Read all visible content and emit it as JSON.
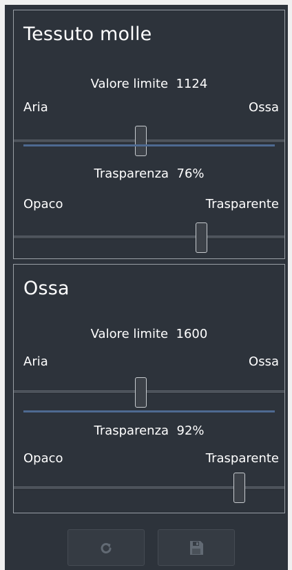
{
  "sections": [
    {
      "title": "Tessuto molle",
      "threshold": {
        "label": "Valore limite",
        "value": "1124",
        "min_label": "Aria",
        "max_label": "Ossa",
        "level": 0.5
      },
      "transparency": {
        "label": "Trasparenza",
        "value": "76%",
        "min_label": "Opaco",
        "max_label": "Trasparente",
        "level": 0.76
      }
    },
    {
      "title": "Ossa",
      "threshold": {
        "label": "Valore limite",
        "value": "1600",
        "min_label": "Aria",
        "max_label": "Ossa",
        "level": 0.5
      },
      "transparency": {
        "label": "Trasparenza",
        "value": "92%",
        "min_label": "Opaco",
        "max_label": "Trasparente",
        "level": 0.92
      }
    }
  ],
  "toolbar": {
    "reset_icon": "reset-icon",
    "save_icon": "save-icon"
  },
  "colors": {
    "panel_bg": "#2d333b",
    "divider": "#4e6a91",
    "border": "#9aa0a6"
  }
}
